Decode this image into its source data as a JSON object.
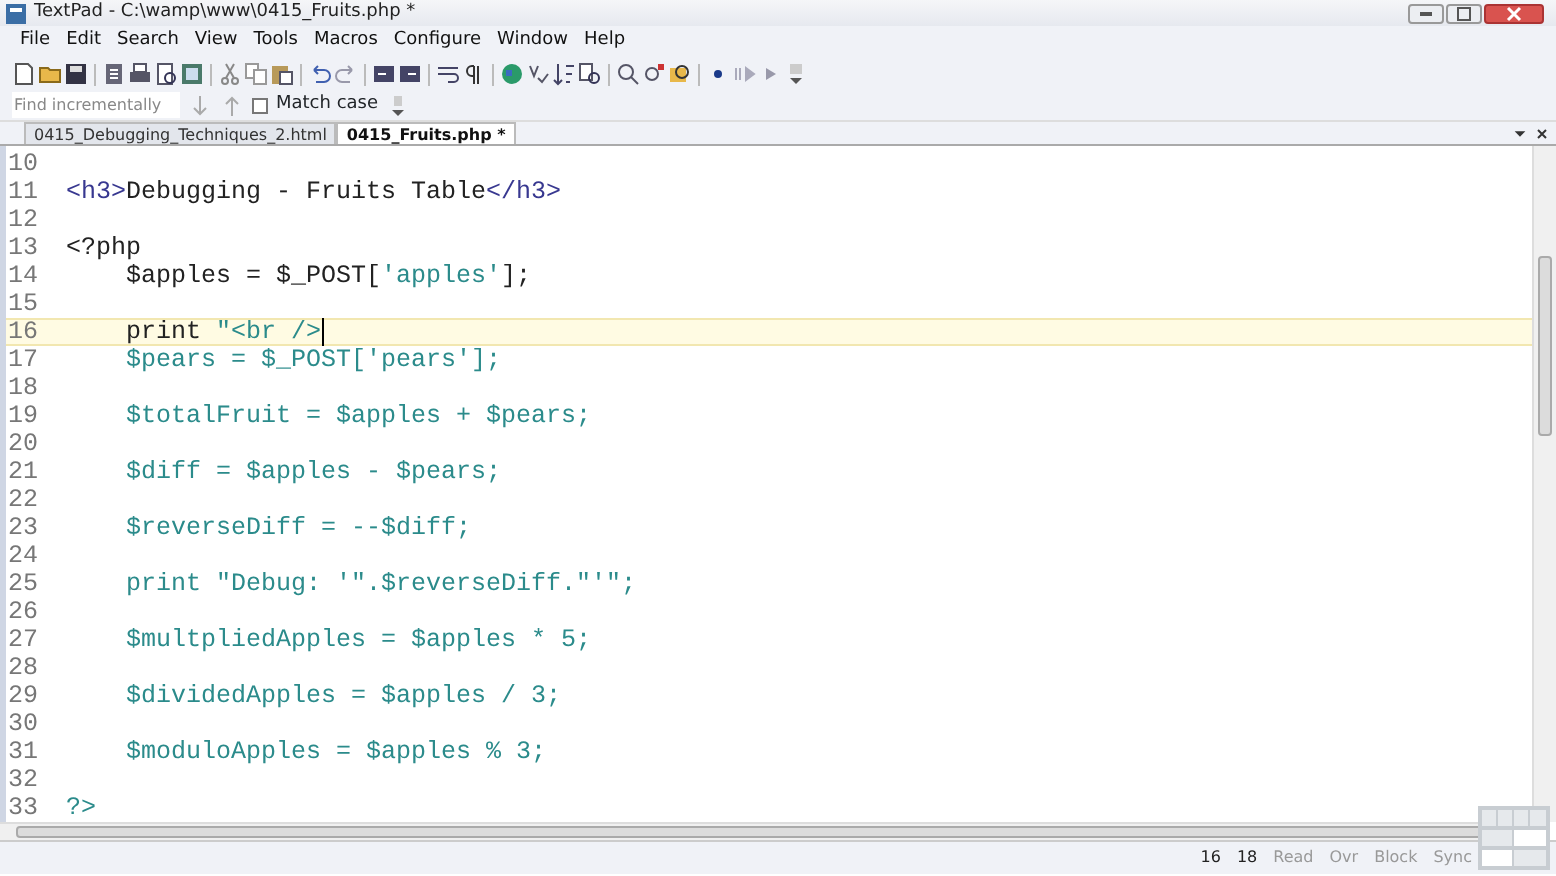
{
  "window": {
    "title": "TextPad - C:\\wamp\\www\\0415_Fruits.php *"
  },
  "menu": [
    "File",
    "Edit",
    "Search",
    "View",
    "Tools",
    "Macros",
    "Configure",
    "Window",
    "Help"
  ],
  "find_bar": {
    "placeholder": "Find incrementally",
    "match_case": {
      "label": "Match case",
      "checked": false
    }
  },
  "tabs": [
    {
      "label": "0415_Debugging_Techniques_2.html",
      "selected": false
    },
    {
      "label": "0415_Fruits.php *",
      "selected": true
    }
  ],
  "editor": {
    "lines": [
      {
        "number": "10",
        "current": false
      },
      {
        "number": "11",
        "current": false,
        "tokens": [
          {
            "kind": "tag",
            "text": "<h3>"
          },
          {
            "kind": "plain",
            "text": "Debugging - Fruits Table"
          },
          {
            "kind": "tag",
            "text": "</h3>"
          }
        ]
      },
      {
        "number": "12",
        "current": false
      },
      {
        "number": "13",
        "current": false,
        "tokens": [
          {
            "kind": "plain",
            "text": "<?php"
          }
        ]
      },
      {
        "number": "14",
        "current": false,
        "tokens": [
          {
            "kind": "plain",
            "text": "    $apples = $_POST["
          },
          {
            "kind": "string",
            "text": "'apples'"
          },
          {
            "kind": "plain",
            "text": "];"
          }
        ]
      },
      {
        "number": "15",
        "current": false
      },
      {
        "number": "16",
        "current": true,
        "tokens": [
          {
            "kind": "plain",
            "text": "    print "
          },
          {
            "kind": "string",
            "text": "\"<br />"
          }
        ]
      },
      {
        "number": "17",
        "current": false,
        "tokens": [
          {
            "kind": "string",
            "text": "    $pears = $_POST['pears'];"
          }
        ]
      },
      {
        "number": "18",
        "current": false
      },
      {
        "number": "19",
        "current": false,
        "tokens": [
          {
            "kind": "string",
            "text": "    $totalFruit = $apples + $pears;"
          }
        ]
      },
      {
        "number": "20",
        "current": false
      },
      {
        "number": "21",
        "current": false,
        "tokens": [
          {
            "kind": "string",
            "text": "    $diff = $apples - $pears;"
          }
        ]
      },
      {
        "number": "22",
        "current": false
      },
      {
        "number": "23",
        "current": false,
        "tokens": [
          {
            "kind": "string",
            "text": "    $reverseDiff = --$diff;"
          }
        ]
      },
      {
        "number": "24",
        "current": false
      },
      {
        "number": "25",
        "current": false,
        "tokens": [
          {
            "kind": "string",
            "text": "    print \"Debug: '\".$reverseDiff.\"'\";"
          }
        ]
      },
      {
        "number": "26",
        "current": false
      },
      {
        "number": "27",
        "current": false,
        "tokens": [
          {
            "kind": "string",
            "text": "    $multpliedApples = $apples * 5;"
          }
        ]
      },
      {
        "number": "28",
        "current": false
      },
      {
        "number": "29",
        "current": false,
        "tokens": [
          {
            "kind": "string",
            "text": "    $dividedApples = $apples / 3;"
          }
        ]
      },
      {
        "number": "30",
        "current": false
      },
      {
        "number": "31",
        "current": false,
        "tokens": [
          {
            "kind": "string",
            "text": "    $moduloApples = $apples % 3;"
          }
        ]
      },
      {
        "number": "32",
        "current": false
      },
      {
        "number": "33",
        "current": false,
        "tokens": [
          {
            "kind": "string",
            "text": "?>"
          }
        ]
      }
    ]
  },
  "status_bar": [
    {
      "text": "16",
      "enabled": true
    },
    {
      "text": "18",
      "enabled": true
    },
    {
      "text": "Read",
      "enabled": false
    },
    {
      "text": "Ovr",
      "enabled": false
    },
    {
      "text": "Block",
      "enabled": false
    },
    {
      "text": "Sync",
      "enabled": false
    }
  ]
}
